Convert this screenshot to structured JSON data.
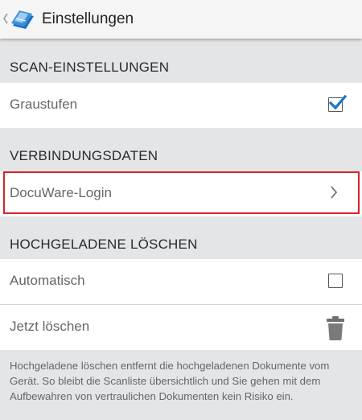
{
  "appbar": {
    "title": "Einstellungen",
    "back_icon": "chevron-left-icon",
    "logo_icon": "docuware-scan-logo"
  },
  "sections": {
    "scan": {
      "header": "SCAN-EINSTELLUNGEN",
      "grayscale_label": "Graustufen",
      "grayscale_checked": true
    },
    "connection": {
      "header": "VERBINDUNGSDATEN",
      "login_label": "DocuWare-Login"
    },
    "delete": {
      "header": "HOCHGELADENE LÖSCHEN",
      "automatic_label": "Automatisch",
      "automatic_checked": false,
      "now_label": "Jetzt löschen",
      "footer": "Hochgeladene löschen entfernt die hochgeladenen Dokumente vom Gerät. So bleibt die Scanliste übersichtlich und Sie gehen mit dem Aufbewahren von vertraulichen Dokumenten kein Risiko ein."
    }
  },
  "colors": {
    "accent": "#1a75c8",
    "highlight": "#d9222a",
    "background": "#e4e5e7"
  }
}
